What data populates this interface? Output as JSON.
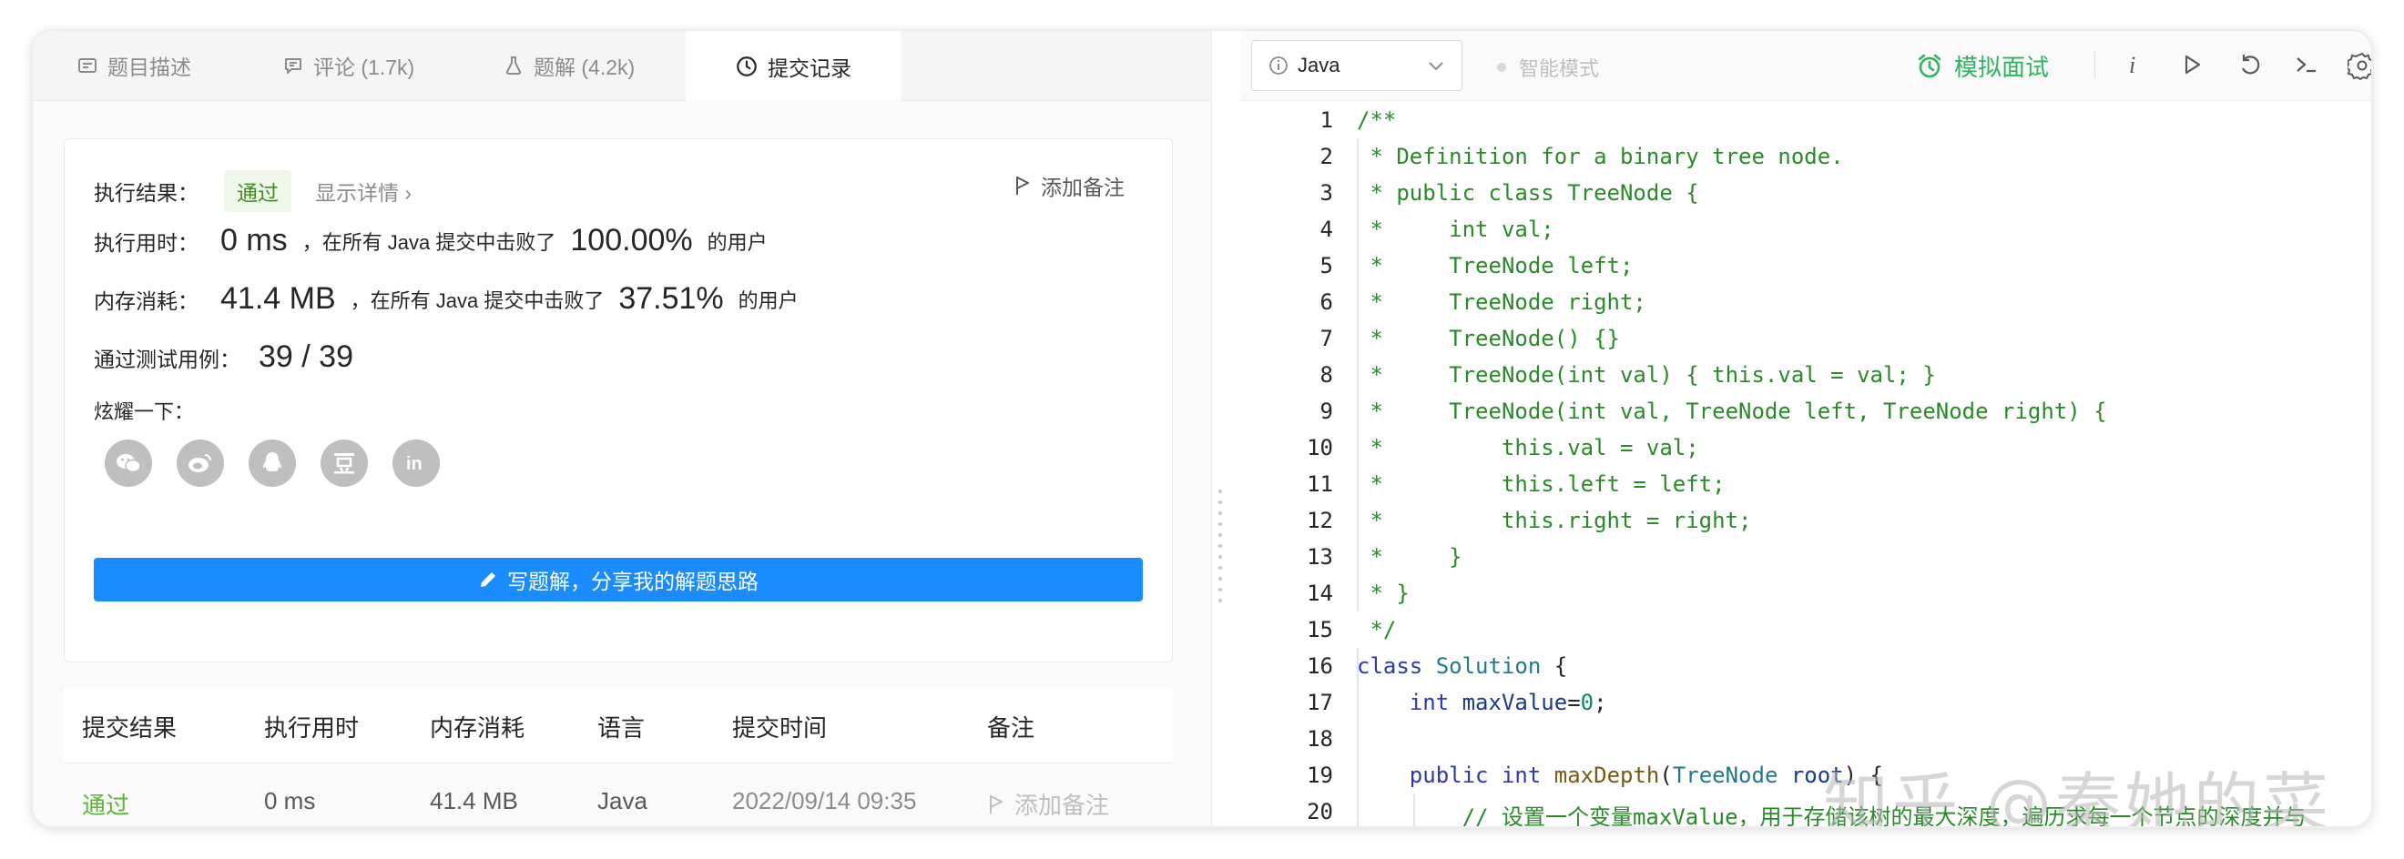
{
  "tabs": {
    "description": "题目描述",
    "comments": "评论 (1.7k)",
    "solutions": "题解 (4.2k)",
    "submissions": "提交记录"
  },
  "result": {
    "exec_label": "执行结果：",
    "status": "通过",
    "details_link": "显示详情 ›",
    "add_note": "添加备注",
    "time_label": "执行用时：",
    "time_value": "0 ms",
    "time_desc": "，在所有 Java 提交中击败了",
    "time_percent": "100.00%",
    "users_suffix": "的用户",
    "mem_label": "内存消耗：",
    "mem_value": "41.4 MB",
    "mem_desc": "，在所有 Java 提交中击败了",
    "mem_percent": "37.51%",
    "tests_label": "通过测试用例：",
    "tests_value": "39  /  39",
    "share_label": "炫耀一下：",
    "share_icons": [
      "wechat-icon",
      "weibo-icon",
      "qq-icon",
      "douban-icon",
      "linkedin-icon"
    ],
    "write_button": "写题解，分享我的解题思路"
  },
  "table": {
    "headers": [
      "提交结果",
      "执行用时",
      "内存消耗",
      "语言",
      "提交时间",
      "备注"
    ],
    "rows": [
      {
        "result": "通过",
        "time": "0 ms",
        "memory": "41.4 MB",
        "language": "Java",
        "submitted": "2022/09/14 09:35",
        "note": "添加备注"
      }
    ]
  },
  "toolbar": {
    "language": "Java",
    "smart_mode": "智能模式",
    "interview": "模拟面试"
  },
  "code": {
    "line_numbers": [
      "1",
      "2",
      "3",
      "4",
      "5",
      "6",
      "7",
      "8",
      "9",
      "10",
      "11",
      "12",
      "13",
      "14",
      "15",
      "16",
      "17",
      "18",
      "19",
      "20"
    ],
    "lines": [
      "/**",
      " * Definition for a binary tree node.",
      " * public class TreeNode {",
      " *     int val;",
      " *     TreeNode left;",
      " *     TreeNode right;",
      " *     TreeNode() {}",
      " *     TreeNode(int val) { this.val = val; }",
      " *     TreeNode(int val, TreeNode left, TreeNode right) {",
      " *         this.val = val;",
      " *         this.left = left;",
      " *         this.right = right;",
      " *     }",
      " * }",
      " */",
      "class Solution {",
      "    int maxValue=0;",
      "",
      "    public int maxDepth(TreeNode root) {",
      "        // 设置一个变量maxValue，用于存储该树的最大深度，遍历求每一个节点的深度并与"
    ]
  },
  "watermark": "知乎 @秦她的菜",
  "colors": {
    "accent_blue": "#1a8cff",
    "pass_green": "#5cb535",
    "interview_green": "#2db55d",
    "comment_green": "#2a8a2a"
  }
}
